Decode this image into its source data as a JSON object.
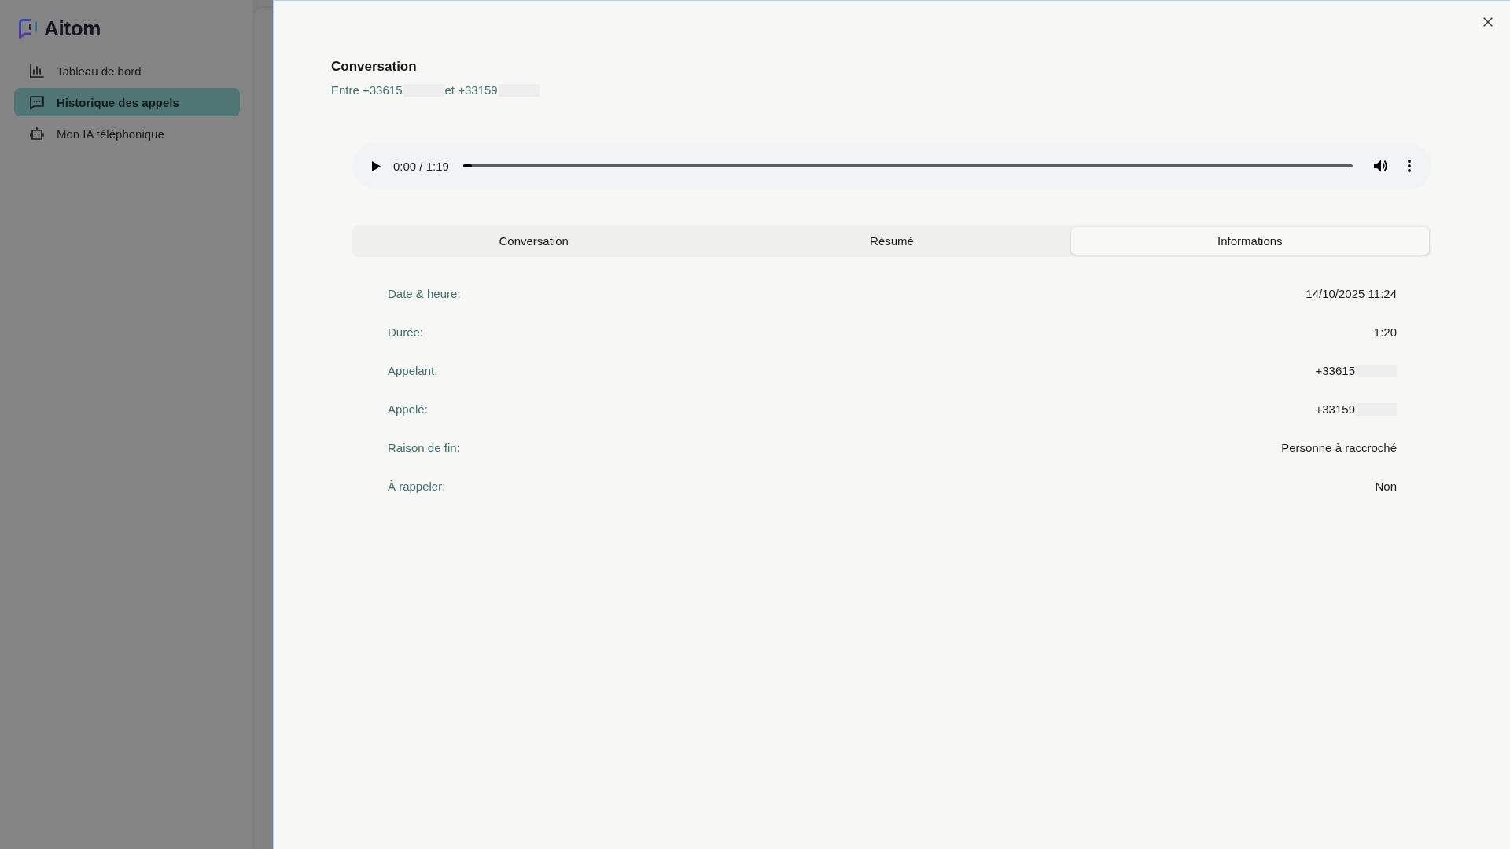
{
  "sidebar": {
    "logo": "Aitom",
    "items": [
      {
        "label": "Tableau de bord",
        "selected": false
      },
      {
        "label": "Historique des appels",
        "selected": true
      },
      {
        "label": "Mon IA téléphonique",
        "selected": false
      }
    ]
  },
  "drawer": {
    "title": "Conversation",
    "subtitle": [
      {
        "text": "Entre +33615",
        "redacted": true
      },
      {
        "text": "et +33159",
        "redacted": true
      }
    ],
    "player": {
      "time": "0:00 / 1:19",
      "level": 0.01
    },
    "tabs": [
      {
        "label": "Conversation",
        "selected": false
      },
      {
        "label": "Résumé",
        "selected": false
      },
      {
        "label": "Informations",
        "selected": true
      }
    ],
    "details": [
      {
        "label": "Date & heure:",
        "value": "14/10/2025 11:24",
        "redacted": false
      },
      {
        "label": "Durée:",
        "value": "1:20",
        "redacted": false
      },
      {
        "label": "Appelant:",
        "value": "+33615",
        "redacted": true
      },
      {
        "label": "Appelé:",
        "value": "+33159",
        "redacted": true
      },
      {
        "label": "Raison de fin:",
        "value": "Personne à raccroché",
        "redacted": false
      },
      {
        "label": "À rappeler:",
        "value": "Non",
        "redacted": false
      }
    ]
  }
}
